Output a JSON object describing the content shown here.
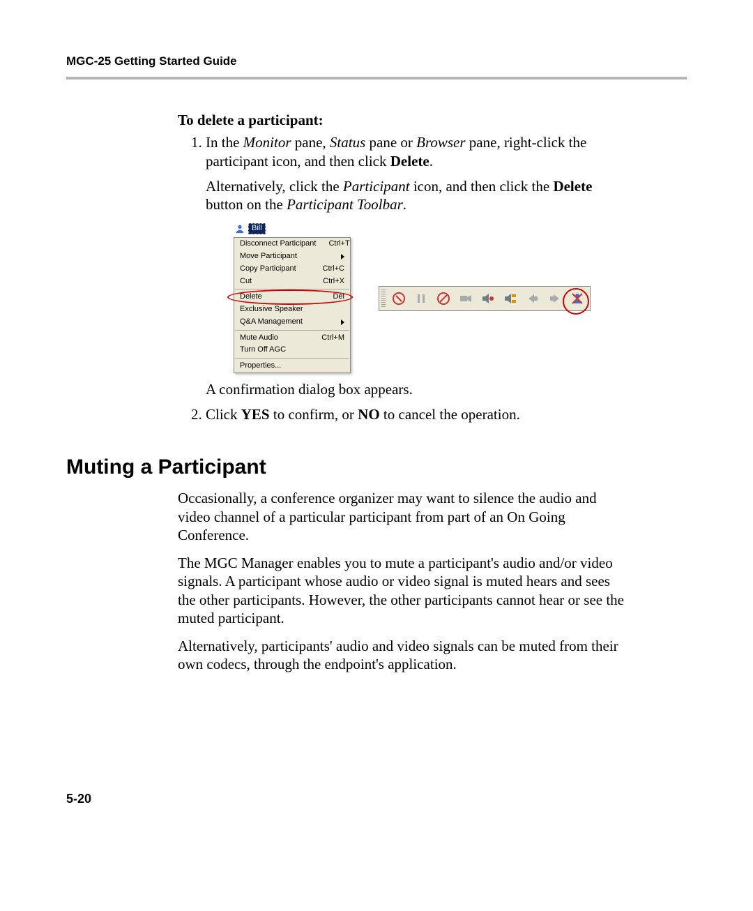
{
  "header": {
    "title": "MGC-25 Getting Started Guide"
  },
  "delete_section": {
    "subhead": "To delete a participant:",
    "step1_a": "In the ",
    "step1_monitor": "Monitor",
    "step1_b": " pane, ",
    "step1_status": "Status",
    "step1_c": " pane or ",
    "step1_browser": "Browser",
    "step1_d": " pane, right-click the participant icon, and then click ",
    "step1_delete": "Delete",
    "step1_e": ".",
    "alt_a": "Alternatively, click the ",
    "alt_participant": "Participant",
    "alt_b": " icon, and then click the ",
    "alt_delete": "Delete",
    "alt_c": " button on the ",
    "alt_toolbar": "Participant Toolbar",
    "alt_d": ".",
    "confirm_text": "A confirmation dialog box appears.",
    "step2_a": "Click ",
    "step2_yes": "YES",
    "step2_b": " to confirm, or ",
    "step2_no": "NO",
    "step2_c": " to cancel the operation."
  },
  "context_menu": {
    "participant_name": "Bill",
    "items": [
      {
        "label": "Disconnect Participant",
        "shortcut": "Ctrl+T",
        "submenu": false
      },
      {
        "label": "Move Participant",
        "shortcut": "",
        "submenu": true
      },
      {
        "label": "Copy Participant",
        "shortcut": "Ctrl+C",
        "submenu": false
      },
      {
        "label": "Cut",
        "shortcut": "Ctrl+X",
        "submenu": false
      }
    ],
    "delete_item": {
      "label": "Delete",
      "shortcut": "Del"
    },
    "items_after": [
      {
        "label": "Exclusive Speaker",
        "shortcut": "",
        "submenu": false
      },
      {
        "label": "Q&A Management",
        "shortcut": "",
        "submenu": true
      }
    ],
    "audio_items": [
      {
        "label": "Mute Audio",
        "shortcut": "Ctrl+M"
      },
      {
        "label": "Turn Off AGC",
        "shortcut": ""
      }
    ],
    "properties_label": "Properties..."
  },
  "muting_section": {
    "heading": "Muting a Participant",
    "p1": "Occasionally, a conference organizer may want to silence the audio and video channel of a particular participant from part of an On Going Conference.",
    "p2": "The MGC Manager enables you to mute a participant's audio and/or video signals. A participant whose audio or video signal is muted hears and sees the other participants. However, the other participants cannot hear or see the muted participant.",
    "p3": "Alternatively, participants' audio and video signals can be muted from their own codecs, through the endpoint's application."
  },
  "page_number": "5-20"
}
